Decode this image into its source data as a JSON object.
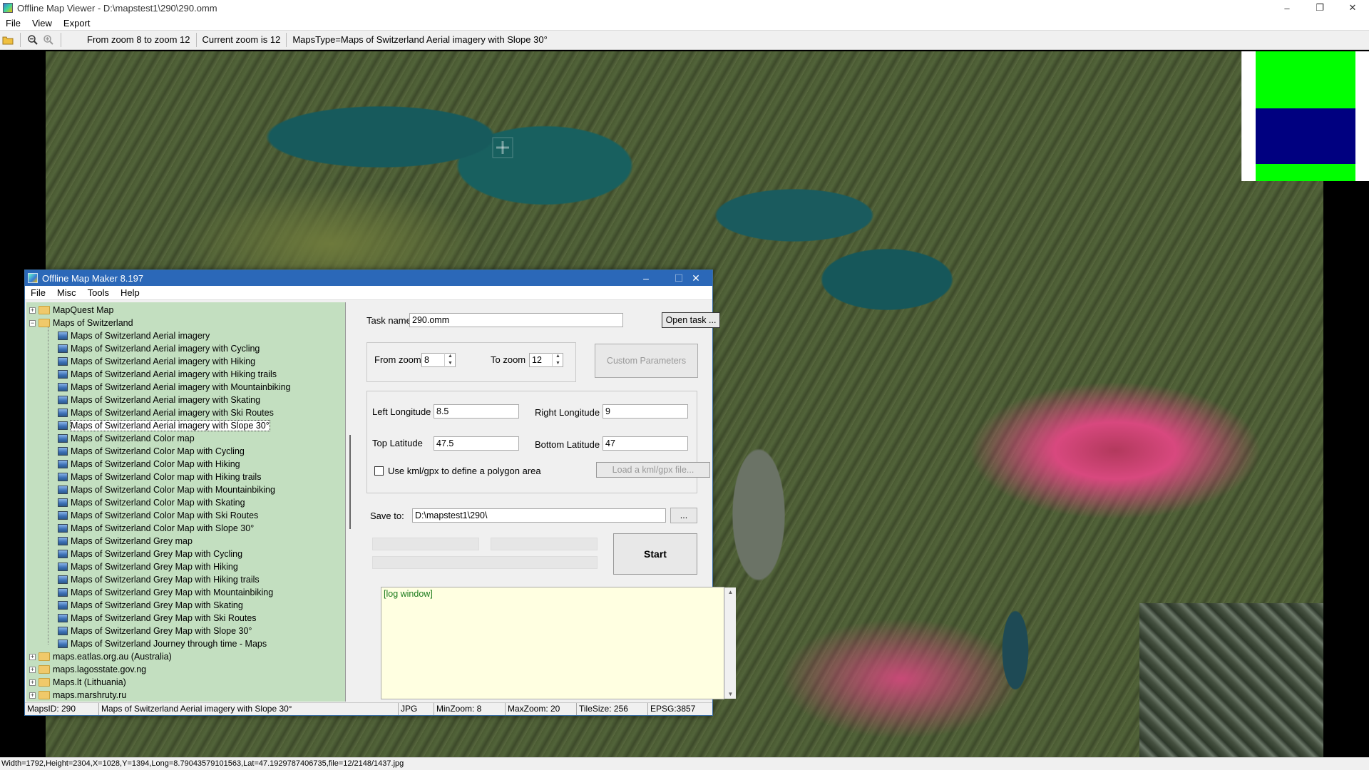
{
  "window": {
    "title": "Offline Map Viewer - D:\\mapstest1\\290\\290.omm",
    "controls": {
      "minimize": "–",
      "maximize": "❐",
      "close": "✕"
    }
  },
  "menu": [
    "File",
    "View",
    "Export"
  ],
  "toolbar": {
    "zoom_range": "From zoom 8 to zoom 12",
    "current_zoom": "Current zoom is 12",
    "maps_type": "MapsType=Maps of Switzerland Aerial imagery with Slope 30°"
  },
  "legend_colors": {
    "green": "#00ff00",
    "navy": "#000080"
  },
  "statusbar": {
    "text": "Width=1792,Height=2304,X=1028,Y=1394,Long=8.79043579101563,Lat=47.1929787406735,file=12/2148/1437.jpg"
  },
  "dialog": {
    "title": "Offline Map Maker 8.197",
    "controls": {
      "minimize": "–",
      "maximize": "☐",
      "close": "✕"
    },
    "menu": [
      "File",
      "Misc",
      "Tools",
      "Help"
    ],
    "tree": {
      "top_nodes_before": [
        {
          "label": "MapQuest Map",
          "expanded": false
        }
      ],
      "group": {
        "label": "Maps of Switzerland",
        "expanded": true
      },
      "children": [
        "Maps of Switzerland Aerial imagery",
        "Maps of Switzerland Aerial imagery with Cycling",
        "Maps of Switzerland Aerial imagery with Hiking",
        "Maps of Switzerland Aerial imagery with Hiking trails",
        "Maps of Switzerland Aerial imagery with Mountainbiking",
        "Maps of Switzerland Aerial imagery with Skating",
        "Maps of Switzerland Aerial imagery with Ski Routes",
        "Maps of Switzerland Aerial imagery with Slope 30°",
        "Maps of Switzerland Color map",
        "Maps of Switzerland Color Map with Cycling",
        "Maps of Switzerland Color Map with Hiking",
        "Maps of Switzerland Color map with Hiking trails",
        "Maps of Switzerland Color Map with Mountainbiking",
        "Maps of Switzerland Color Map with Skating",
        "Maps of Switzerland Color Map with Ski Routes",
        "Maps of Switzerland Color Map with Slope 30°",
        "Maps of Switzerland Grey map",
        "Maps of Switzerland Grey Map with Cycling",
        "Maps of Switzerland Grey Map with Hiking",
        "Maps of Switzerland Grey Map with Hiking trails",
        "Maps of Switzerland Grey Map with Mountainbiking",
        "Maps of Switzerland Grey Map with Skating",
        "Maps of Switzerland Grey Map with Ski Routes",
        "Maps of Switzerland Grey Map with Slope 30°",
        "Maps of Switzerland Journey through time - Maps"
      ],
      "selected": "Maps of Switzerland Aerial imagery with Slope 30°",
      "top_nodes_after": [
        "maps.eatlas.org.au (Australia)",
        "maps.lagosstate.gov.ng",
        "Maps.lt (Lithuania)",
        "maps.marshruty.ru"
      ]
    },
    "form": {
      "task_name_label": "Task name",
      "task_name": "290.omm",
      "open_task": "Open task ...",
      "from_zoom_label": "From zoom",
      "from_zoom": "8",
      "to_zoom_label": "To zoom",
      "to_zoom": "12",
      "custom_params": "Custom Parameters",
      "left_lon_label": "Left Longitude",
      "left_lon": "8.5",
      "right_lon_label": "Right Longitude",
      "right_lon": "9",
      "top_lat_label": "Top Latitude",
      "top_lat": "47.5",
      "bottom_lat_label": "Bottom Latitude",
      "bottom_lat": "47",
      "kml_label": "Use kml/gpx to define a polygon area",
      "load_kml": "Load a kml/gpx file...",
      "save_to_label": "Save to:",
      "save_to": "D:\\mapstest1\\290\\",
      "browse": "...",
      "start": "Start"
    },
    "log": "[log window]",
    "status": {
      "maps_id": "MapsID: 290",
      "maps_name": "Maps of Switzerland Aerial imagery with Slope 30°",
      "format": "JPG",
      "min_zoom": "MinZoom: 8",
      "max_zoom": "MaxZoom: 20",
      "tile_size": "TileSize: 256",
      "epsg": "EPSG:3857"
    }
  }
}
